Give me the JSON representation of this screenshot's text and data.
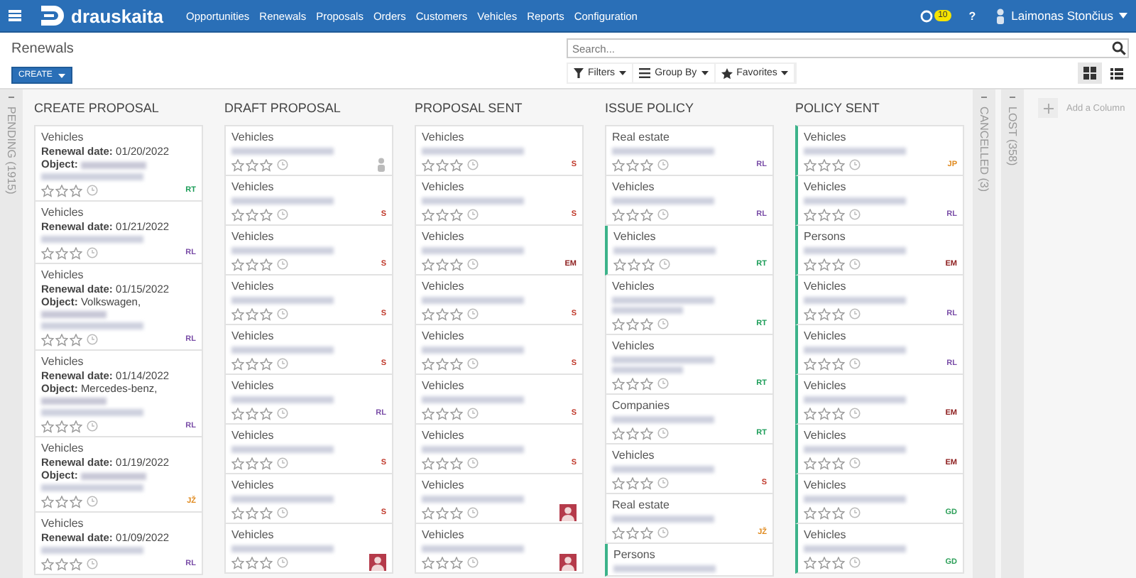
{
  "navbar": {
    "brand": "drauskaita",
    "menu": [
      "Opportunities",
      "Renewals",
      "Proposals",
      "Orders",
      "Customers",
      "Vehicles",
      "Reports",
      "Configuration"
    ],
    "badge": "10",
    "help": "?",
    "user": "Laimonas Stončius"
  },
  "control_panel": {
    "breadcrumb": "Renewals",
    "create": "CREATE",
    "search": {
      "placeholder": "Search..."
    },
    "filters": [
      "Filters",
      "Group By",
      "Favorites"
    ],
    "views": [
      {
        "kind": "kanban",
        "selected": true
      },
      {
        "kind": "list",
        "selected": false
      }
    ]
  },
  "columns": [
    {
      "kind": "folded",
      "title": "PENDING (1915)"
    },
    {
      "kind": "open",
      "title": "CREATE PROPOSAL",
      "cards": [
        {
          "category": "Vehicles",
          "details": [
            {
              "label": "Renewal date:",
              "value": "01/20/2022"
            },
            {
              "label": "Object:",
              "redacted": true
            }
          ],
          "stars": 0,
          "highlighted": false,
          "assignee": {
            "kind": "initials",
            "text": "RT",
            "color": "#1e9e5a"
          }
        },
        {
          "category": "Vehicles",
          "details": [
            {
              "label": "Renewal date:",
              "value": "01/21/2022"
            }
          ],
          "stars": 0,
          "highlighted": false,
          "assignee": {
            "kind": "initials",
            "text": "RL",
            "color": "#7b4fa8"
          }
        },
        {
          "category": "Vehicles",
          "details": [
            {
              "label": "Renewal date:",
              "value": "01/15/2022"
            },
            {
              "label": "Object:",
              "value": "Volkswagen,",
              "redacted": true
            }
          ],
          "stars": 0,
          "highlighted": false,
          "assignee": {
            "kind": "initials",
            "text": "RL",
            "color": "#7b4fa8"
          }
        },
        {
          "category": "Vehicles",
          "details": [
            {
              "label": "Renewal date:",
              "value": "01/14/2022"
            },
            {
              "label": "Object:",
              "value": "Mercedes-benz,",
              "redacted": true
            }
          ],
          "stars": 0,
          "highlighted": false,
          "assignee": {
            "kind": "initials",
            "text": "RL",
            "color": "#7b4fa8"
          }
        },
        {
          "category": "Vehicles",
          "details": [
            {
              "label": "Renewal date:",
              "value": "01/19/2022"
            },
            {
              "label": "Object:",
              "redacted": true
            }
          ],
          "stars": 0,
          "highlighted": false,
          "assignee": {
            "kind": "initials",
            "text": "JŽ",
            "color": "#e08a1e"
          }
        },
        {
          "category": "Vehicles",
          "details": [
            {
              "label": "Renewal date:",
              "value": "01/09/2022"
            }
          ],
          "stars": 0,
          "highlighted": false,
          "assignee": {
            "kind": "initials",
            "text": "RL",
            "color": "#7b4fa8"
          }
        }
      ]
    },
    {
      "kind": "open",
      "title": "DRAFT PROPOSAL",
      "cards": [
        {
          "category": "Vehicles",
          "stars": 0,
          "highlighted": false,
          "assignee": {
            "kind": "user-icon"
          }
        },
        {
          "category": "Vehicles",
          "stars": 0,
          "highlighted": false,
          "assignee": {
            "kind": "initials",
            "text": "S",
            "color": "#c0392b"
          }
        },
        {
          "category": "Vehicles",
          "stars": 0,
          "highlighted": false,
          "assignee": {
            "kind": "initials",
            "text": "S",
            "color": "#c0392b"
          }
        },
        {
          "category": "Vehicles",
          "stars": 0,
          "highlighted": false,
          "assignee": {
            "kind": "initials",
            "text": "S",
            "color": "#c0392b"
          }
        },
        {
          "category": "Vehicles",
          "stars": 0,
          "highlighted": false,
          "assignee": {
            "kind": "initials",
            "text": "S",
            "color": "#c0392b"
          }
        },
        {
          "category": "Vehicles",
          "stars": 0,
          "highlighted": false,
          "assignee": {
            "kind": "initials",
            "text": "RL",
            "color": "#7b4fa8"
          }
        },
        {
          "category": "Vehicles",
          "stars": 0,
          "highlighted": false,
          "assignee": {
            "kind": "initials",
            "text": "S",
            "color": "#c0392b"
          }
        },
        {
          "category": "Vehicles",
          "stars": 0,
          "highlighted": false,
          "assignee": {
            "kind": "initials",
            "text": "S",
            "color": "#c0392b"
          }
        },
        {
          "category": "Vehicles",
          "stars": 0,
          "highlighted": false,
          "assignee": {
            "kind": "avatar"
          }
        }
      ]
    },
    {
      "kind": "open",
      "title": "PROPOSAL SENT",
      "cards": [
        {
          "category": "Vehicles",
          "stars": 0,
          "highlighted": false,
          "assignee": {
            "kind": "initials",
            "text": "S",
            "color": "#c0392b"
          }
        },
        {
          "category": "Vehicles",
          "stars": 0,
          "highlighted": false,
          "assignee": {
            "kind": "initials",
            "text": "S",
            "color": "#c0392b"
          }
        },
        {
          "category": "Vehicles",
          "stars": 0,
          "highlighted": false,
          "assignee": {
            "kind": "initials",
            "text": "EM",
            "color": "#8b1a1a"
          }
        },
        {
          "category": "Vehicles",
          "stars": 0,
          "highlighted": false,
          "assignee": {
            "kind": "initials",
            "text": "S",
            "color": "#c0392b"
          }
        },
        {
          "category": "Vehicles",
          "stars": 0,
          "highlighted": false,
          "assignee": {
            "kind": "initials",
            "text": "S",
            "color": "#c0392b"
          }
        },
        {
          "category": "Vehicles",
          "stars": 0,
          "highlighted": false,
          "assignee": {
            "kind": "initials",
            "text": "S",
            "color": "#c0392b"
          }
        },
        {
          "category": "Vehicles",
          "stars": 0,
          "highlighted": false,
          "assignee": {
            "kind": "initials",
            "text": "S",
            "color": "#c0392b"
          }
        },
        {
          "category": "Vehicles",
          "stars": 0,
          "highlighted": false,
          "assignee": {
            "kind": "avatar"
          }
        },
        {
          "category": "Vehicles",
          "stars": 0,
          "highlighted": false,
          "assignee": {
            "kind": "avatar"
          }
        }
      ]
    },
    {
      "kind": "open",
      "title": "ISSUE POLICY",
      "cards": [
        {
          "category": "Real estate",
          "stars": 0,
          "highlighted": false,
          "assignee": {
            "kind": "initials",
            "text": "RL",
            "color": "#7b4fa8"
          }
        },
        {
          "category": "Vehicles",
          "stars": 0,
          "highlighted": false,
          "assignee": {
            "kind": "initials",
            "text": "RL",
            "color": "#7b4fa8"
          }
        },
        {
          "category": "Vehicles",
          "stars": 0,
          "highlighted": true,
          "assignee": {
            "kind": "initials",
            "text": "RT",
            "color": "#1e9e5a"
          }
        },
        {
          "category": "Vehicles",
          "long_name": true,
          "stars": 0,
          "highlighted": false,
          "assignee": {
            "kind": "initials",
            "text": "RT",
            "color": "#1e9e5a"
          }
        },
        {
          "category": "Vehicles",
          "long_name": true,
          "stars": 0,
          "highlighted": false,
          "assignee": {
            "kind": "initials",
            "text": "RT",
            "color": "#1e9e5a"
          }
        },
        {
          "category": "Companies",
          "stars": 0,
          "highlighted": false,
          "assignee": {
            "kind": "initials",
            "text": "RT",
            "color": "#1e9e5a"
          }
        },
        {
          "category": "Vehicles",
          "stars": 0,
          "highlighted": false,
          "assignee": {
            "kind": "initials",
            "text": "S",
            "color": "#c0392b"
          }
        },
        {
          "category": "Real estate",
          "stars": 0,
          "highlighted": false,
          "assignee": {
            "kind": "initials",
            "text": "JŽ",
            "color": "#e08a1e"
          }
        },
        {
          "category": "Persons",
          "highlighted": true
        }
      ]
    },
    {
      "kind": "open",
      "title": "POLICY SENT",
      "cards": [
        {
          "category": "Vehicles",
          "stars": 0,
          "highlighted": true,
          "assignee": {
            "kind": "initials",
            "text": "JP",
            "color": "#e08a1e"
          }
        },
        {
          "category": "Vehicles",
          "stars": 0,
          "highlighted": true,
          "assignee": {
            "kind": "initials",
            "text": "RL",
            "color": "#7b4fa8"
          }
        },
        {
          "category": "Persons",
          "stars": 0,
          "highlighted": true,
          "assignee": {
            "kind": "initials",
            "text": "EM",
            "color": "#8b1a1a"
          }
        },
        {
          "category": "Vehicles",
          "stars": 0,
          "highlighted": true,
          "assignee": {
            "kind": "initials",
            "text": "RL",
            "color": "#7b4fa8"
          }
        },
        {
          "category": "Vehicles",
          "stars": 0,
          "highlighted": true,
          "assignee": {
            "kind": "initials",
            "text": "RL",
            "color": "#7b4fa8"
          }
        },
        {
          "category": "Vehicles",
          "stars": 0,
          "highlighted": true,
          "assignee": {
            "kind": "initials",
            "text": "EM",
            "color": "#8b1a1a"
          }
        },
        {
          "category": "Vehicles",
          "stars": 0,
          "highlighted": true,
          "assignee": {
            "kind": "initials",
            "text": "EM",
            "color": "#8b1a1a"
          }
        },
        {
          "category": "Vehicles",
          "stars": 0,
          "highlighted": true,
          "assignee": {
            "kind": "initials",
            "text": "GD",
            "color": "#2ea05a"
          }
        },
        {
          "category": "Vehicles",
          "stars": 0,
          "highlighted": true,
          "assignee": {
            "kind": "initials",
            "text": "GD",
            "color": "#2ea05a"
          }
        }
      ]
    },
    {
      "kind": "folded",
      "title": "CANCELLED (3)"
    },
    {
      "kind": "folded",
      "title": "LOST (358)"
    }
  ],
  "add_column": "Add a Column"
}
